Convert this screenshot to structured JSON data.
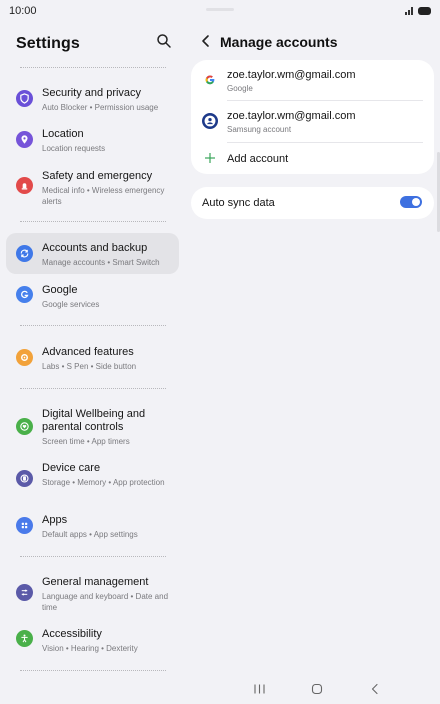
{
  "status_bar": {
    "time": "10:00"
  },
  "left_panel": {
    "title": "Settings",
    "items": [
      {
        "id": "security",
        "title": "Security and privacy",
        "subtitle": "Auto Blocker  •  Permission usage",
        "icon": "shield-icon",
        "color": "#6a50d8"
      },
      {
        "id": "location",
        "title": "Location",
        "subtitle": "Location requests",
        "icon": "location-pin-icon",
        "color": "#7654d9"
      },
      {
        "id": "safety",
        "title": "Safety and emergency",
        "subtitle": "Medical info  •  Wireless emergency alerts",
        "icon": "alert-icon",
        "color": "#e24a4a"
      },
      {
        "id": "accounts",
        "title": "Accounts and backup",
        "subtitle": "Manage accounts  •  Smart Switch",
        "icon": "sync-icon",
        "color": "#3f78e8",
        "selected": true
      },
      {
        "id": "google",
        "title": "Google",
        "subtitle": "Google services",
        "icon": "google-g-icon",
        "color": "#4680ec"
      },
      {
        "id": "advanced",
        "title": "Advanced features",
        "subtitle": "Labs  •  S Pen  •  Side button",
        "icon": "gear-plus-icon",
        "color": "#f2a23a"
      },
      {
        "id": "wellbeing",
        "title": "Digital Wellbeing and parental controls",
        "subtitle": "Screen time  •  App timers",
        "icon": "heart-circle-icon",
        "color": "#4ab04a"
      },
      {
        "id": "device",
        "title": "Device care",
        "subtitle": "Storage  •  Memory  •  App protection",
        "icon": "device-care-icon",
        "color": "#5b5aa8"
      },
      {
        "id": "apps",
        "title": "Apps",
        "subtitle": "Default apps  •  App settings",
        "icon": "apps-grid-icon",
        "color": "#4a7aea"
      },
      {
        "id": "general",
        "title": "General management",
        "subtitle": "Language and keyboard  •  Date and time",
        "icon": "sliders-icon",
        "color": "#5b5aa8"
      },
      {
        "id": "accessibility",
        "title": "Accessibility",
        "subtitle": "Vision  •  Hearing  •  Dexterity",
        "icon": "accessibility-icon",
        "color": "#4ab04a"
      }
    ]
  },
  "right_panel": {
    "title": "Manage accounts",
    "accounts": [
      {
        "email": "zoe.taylor.wm@gmail.com",
        "type": "Google",
        "icon": "google-logo-icon"
      },
      {
        "email": "zoe.taylor.wm@gmail.com",
        "type": "Samsung account",
        "icon": "samsung-account-icon"
      }
    ],
    "add_account_label": "Add account",
    "auto_sync_label": "Auto sync data",
    "auto_sync_enabled": true,
    "accent_color": "#3e70e0"
  },
  "navigation_bar": {
    "buttons": [
      "recents-icon",
      "home-icon",
      "back-icon"
    ]
  }
}
